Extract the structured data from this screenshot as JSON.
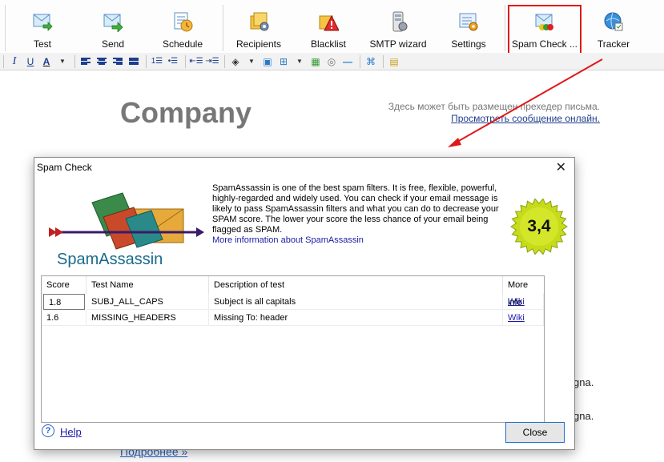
{
  "toolbar": {
    "buttons": [
      {
        "label": "Test",
        "icon": "test-icon"
      },
      {
        "label": "Send",
        "icon": "send-icon"
      },
      {
        "label": "Schedule",
        "icon": "schedule-icon"
      },
      {
        "label": "Recipients",
        "icon": "recipients-icon"
      },
      {
        "label": "Blacklist",
        "icon": "blacklist-icon"
      },
      {
        "label": "SMTP wizard",
        "icon": "smtp-wizard-icon"
      },
      {
        "label": "Settings",
        "icon": "settings-icon"
      },
      {
        "label": "Spam Check ...",
        "icon": "spam-check-icon"
      },
      {
        "label": "Tracker",
        "icon": "tracker-icon"
      }
    ],
    "highlight_color": "#e01818"
  },
  "format_toolbar": {
    "italic": "I",
    "underline": "U",
    "font_color": "A"
  },
  "editor": {
    "company": "Company",
    "preheader": "Здесь может быть размещен прехедер письма.",
    "view_online": "Просмотреть сообщение онлайн.",
    "fragment1": "gna.",
    "fragment2": "gna.",
    "more_link": "Подробнее »"
  },
  "dialog": {
    "title": "Spam Check",
    "logo_text": "SpamAssassin",
    "description": "SpamAssassin is one of the best spam filters. It is free, flexible, powerful, highly-regarded and widely used. You can check if your email message is likely to pass SpamAssassin filters and what you can do to decrease your SPAM score. The lower your score the less chance of your email being flagged as SPAM.",
    "more_info_link": "More information about SpamAssassin",
    "score_badge": "3,4",
    "table": {
      "headers": [
        "Score",
        "Test Name",
        "Description of test",
        "More info"
      ],
      "rows": [
        {
          "score": "1.8",
          "test": "SUBJ_ALL_CAPS",
          "desc": "Subject is all capitals",
          "info": "Wiki"
        },
        {
          "score": "1.6",
          "test": "MISSING_HEADERS",
          "desc": "Missing To: header",
          "info": "Wiki"
        }
      ]
    },
    "help_label": "Help",
    "close_label": "Close"
  }
}
